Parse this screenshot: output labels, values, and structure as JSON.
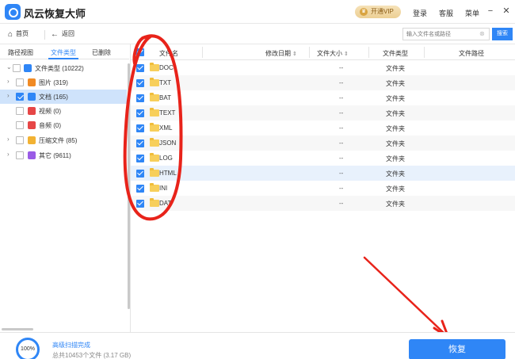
{
  "app": {
    "title": "风云恢复大师"
  },
  "header": {
    "vip_label": "开通VIP",
    "vip_icon": "crown-icon",
    "login": "登录",
    "service": "客服",
    "menu": "菜单",
    "minimize": "−",
    "close": "✕"
  },
  "nav": {
    "home": "首页",
    "back": "返回",
    "search_placeholder": "输入文件名或路径",
    "search_button": "搜索"
  },
  "left_tabs": {
    "path_view": "路径视图",
    "file_type": "文件类型",
    "deleted": "已删除"
  },
  "tree": [
    {
      "label": "文件类型 (10222)",
      "icon": "drive-icon",
      "color": "#2f86f6"
    },
    {
      "label": "图片 (319)",
      "icon": "image-icon",
      "color": "#f08a24"
    },
    {
      "label": "文档 (165)",
      "icon": "document-icon",
      "color": "#2f86f6"
    },
    {
      "label": "视频 (0)",
      "icon": "video-icon",
      "color": "#e64646"
    },
    {
      "label": "音频 (0)",
      "icon": "audio-icon",
      "color": "#e64646"
    },
    {
      "label": "压缩文件 (85)",
      "icon": "archive-icon",
      "color": "#f2b233"
    },
    {
      "label": "其它 (9611)",
      "icon": "other-icon",
      "color": "#9a5ce6"
    }
  ],
  "table": {
    "headers": {
      "name": "文件名",
      "modified": "修改日期",
      "size": "文件大小",
      "type": "文件类型",
      "path": "文件路径"
    },
    "rows": [
      {
        "name": "DOC",
        "size": "--",
        "type": "文件夹"
      },
      {
        "name": "TXT",
        "size": "--",
        "type": "文件夹"
      },
      {
        "name": "BAT",
        "size": "--",
        "type": "文件夹"
      },
      {
        "name": "TEXT",
        "size": "--",
        "type": "文件夹"
      },
      {
        "name": "XML",
        "size": "--",
        "type": "文件夹"
      },
      {
        "name": "JSON",
        "size": "--",
        "type": "文件夹"
      },
      {
        "name": "LOG",
        "size": "--",
        "type": "文件夹"
      },
      {
        "name": "HTML",
        "size": "--",
        "type": "文件夹"
      },
      {
        "name": "INI",
        "size": "--",
        "type": "文件夹"
      },
      {
        "name": "DAT",
        "size": "--",
        "type": "文件夹"
      }
    ]
  },
  "footer": {
    "progress_label": "100%",
    "progress_value": 1.0,
    "status_title": "高级扫描完成",
    "status_sub": "总共10453个文件 (3.17 GB)",
    "recover_button": "恢复"
  },
  "colors": {
    "accent": "#2f86f6",
    "annotation": "#e8231a"
  }
}
